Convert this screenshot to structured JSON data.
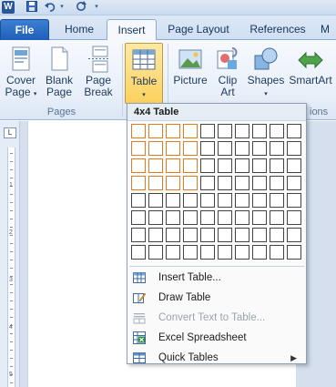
{
  "quick_access": {
    "app_icon": "word-icon",
    "app_letter": "W",
    "save_icon": "save-icon",
    "undo_icon": "undo-icon",
    "redo_icon": "redo-icon"
  },
  "tabs": {
    "file": "File",
    "home": "Home",
    "insert": "Insert",
    "page_layout": "Page Layout",
    "references": "References",
    "cut_off": "M"
  },
  "ribbon": {
    "cover_page": "Cover Page",
    "cover_page_l1": "Cover",
    "cover_page_l2": "Page",
    "blank_page_l1": "Blank",
    "blank_page_l2": "Page",
    "page_break_l1": "Page",
    "page_break_l2": "Break",
    "table": "Table",
    "picture": "Picture",
    "clip_art_l1": "Clip",
    "clip_art_l2": "Art",
    "shapes": "Shapes",
    "smartart": "SmartArt",
    "pages_group": "Pages",
    "illustrations_group_partial": "ions"
  },
  "ruler": {
    "tab_selector": "L",
    "numbers": [
      "1",
      "2",
      "3",
      "4",
      "5"
    ]
  },
  "dropdown": {
    "title": "4x4 Table",
    "grid_columns": 10,
    "grid_rows": 8,
    "selected_columns": 4,
    "selected_rows": 4,
    "items": [
      {
        "label": "Insert Table...",
        "enabled": true,
        "submenu": false,
        "icon": "insert-table-icon"
      },
      {
        "label": "Draw Table",
        "enabled": true,
        "submenu": false,
        "icon": "draw-table-icon"
      },
      {
        "label": "Convert Text to Table...",
        "enabled": false,
        "submenu": false,
        "icon": "convert-text-icon"
      },
      {
        "label": "Excel Spreadsheet",
        "enabled": true,
        "submenu": false,
        "icon": "excel-spreadsheet-icon"
      },
      {
        "label": "Quick Tables",
        "enabled": true,
        "submenu": true,
        "icon": "quick-tables-icon"
      }
    ]
  },
  "colors": {
    "selection_border": "#e07b21",
    "file_tab": "#2a6ac4",
    "pressed_button": "#fbd15e"
  }
}
